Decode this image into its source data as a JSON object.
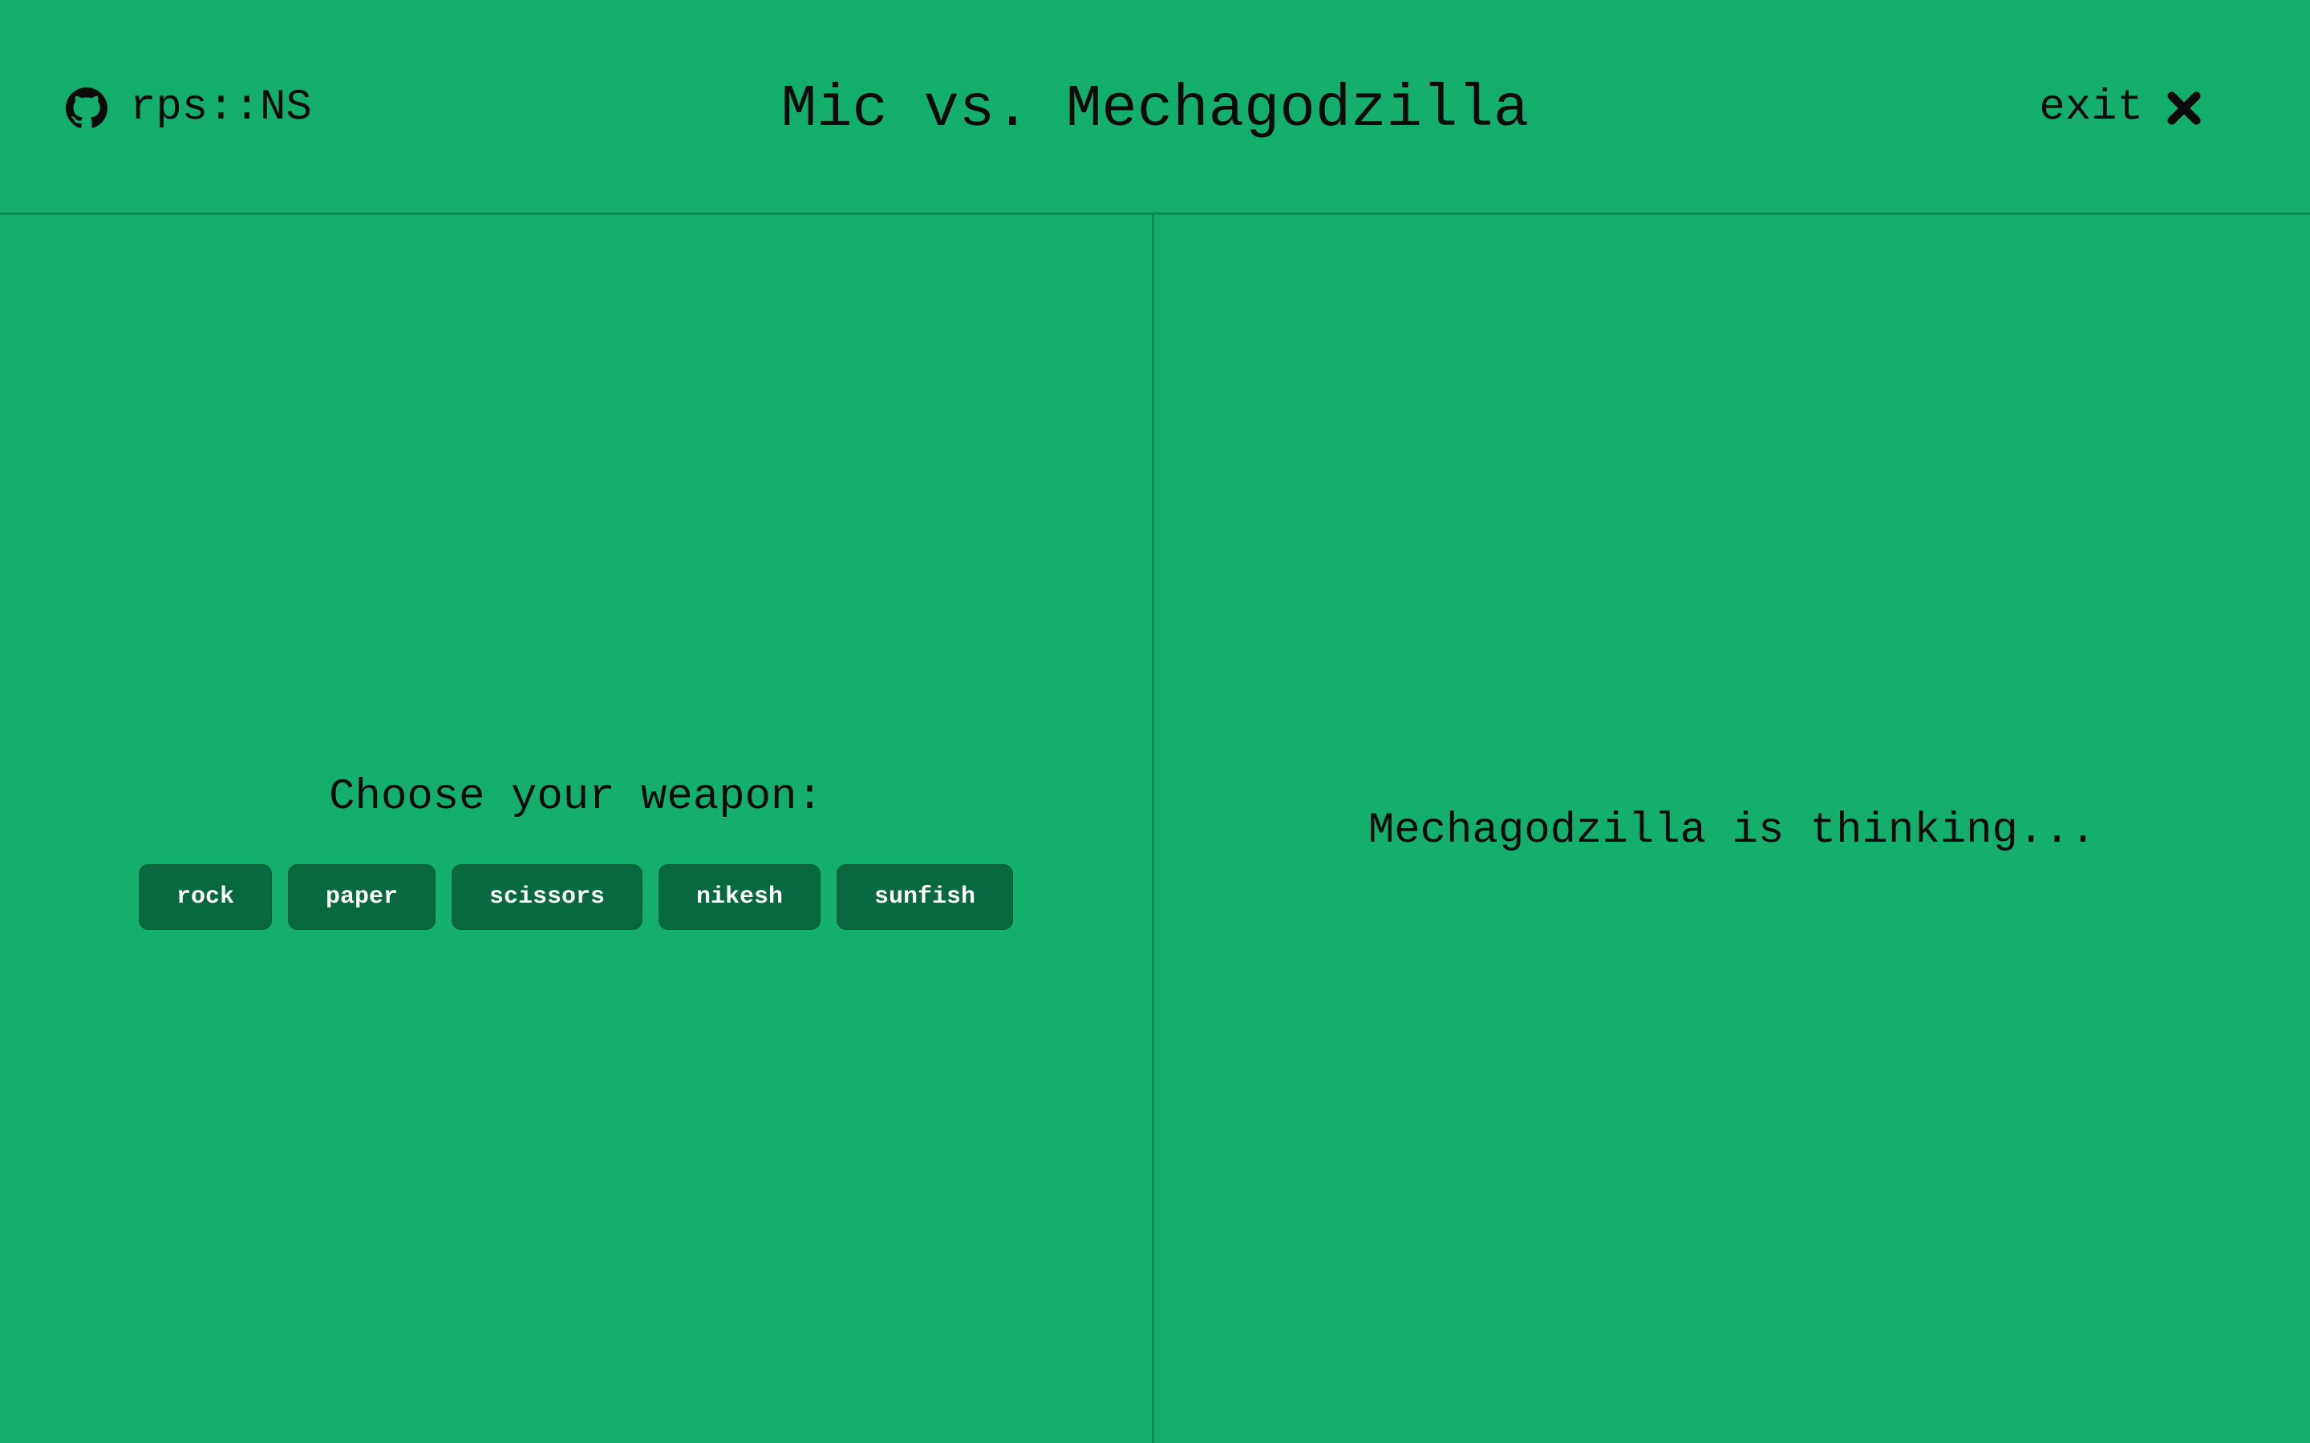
{
  "header": {
    "brand_label": "rps::NS",
    "brand_icon": "github-icon",
    "title": "Mic vs. Mechagodzilla",
    "exit_label": "exit",
    "exit_icon": "close-icon"
  },
  "player": {
    "prompt": "Choose your weapon:",
    "weapons": [
      "rock",
      "paper",
      "scissors",
      "nikesh",
      "sunfish"
    ]
  },
  "opponent": {
    "status": "Mechagodzilla is thinking..."
  },
  "colors": {
    "background": "#14ae6d",
    "button": "#08683f",
    "divider": "#0f8a56",
    "text": "#0b0b0b",
    "button_text": "#ffffff"
  }
}
